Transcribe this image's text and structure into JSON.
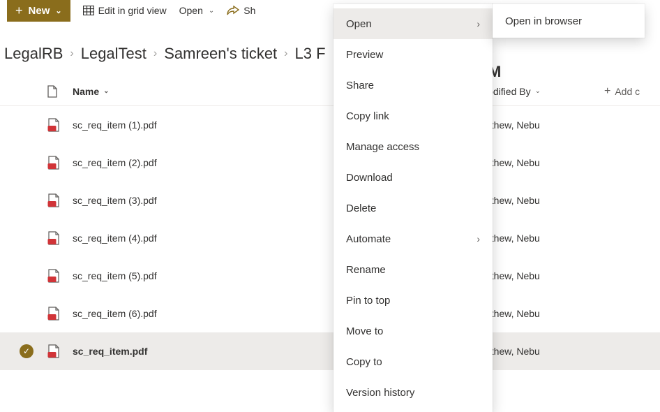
{
  "toolbar": {
    "new_label": "New",
    "edit_grid_label": "Edit in grid view",
    "open_label": "Open",
    "share_label": "Sh"
  },
  "breadcrumb": {
    "items": [
      "LegalRB",
      "LegalTest",
      "Samreen's ticket",
      "L3 F"
    ],
    "tail_fragment": "M"
  },
  "columns": {
    "name_label": "Name",
    "modified_by_label": "lodified By",
    "add_column_label": "Add c"
  },
  "rows": [
    {
      "name": "sc_req_item (1).pdf",
      "modified_by": "athew, Nebu",
      "selected": false
    },
    {
      "name": "sc_req_item (2).pdf",
      "modified_by": "athew, Nebu",
      "selected": false
    },
    {
      "name": "sc_req_item (3).pdf",
      "modified_by": "athew, Nebu",
      "selected": false
    },
    {
      "name": "sc_req_item (4).pdf",
      "modified_by": "athew, Nebu",
      "selected": false
    },
    {
      "name": "sc_req_item (5).pdf",
      "modified_by": "athew, Nebu",
      "selected": false
    },
    {
      "name": "sc_req_item (6).pdf",
      "modified_by": "athew, Nebu",
      "selected": false
    },
    {
      "name": "sc_req_item.pdf",
      "modified_by": "athew, Nebu",
      "selected": true
    }
  ],
  "context_menu": {
    "items": [
      {
        "label": "Open",
        "has_submenu": true,
        "highlight": true
      },
      {
        "label": "Preview"
      },
      {
        "label": "Share"
      },
      {
        "label": "Copy link"
      },
      {
        "label": "Manage access"
      },
      {
        "label": "Download"
      },
      {
        "label": "Delete"
      },
      {
        "label": "Automate",
        "has_submenu": true
      },
      {
        "label": "Rename"
      },
      {
        "label": "Pin to top"
      },
      {
        "label": "Move to"
      },
      {
        "label": "Copy to"
      },
      {
        "label": "Version history"
      }
    ],
    "submenu": {
      "items": [
        {
          "label": "Open in browser"
        }
      ]
    }
  }
}
